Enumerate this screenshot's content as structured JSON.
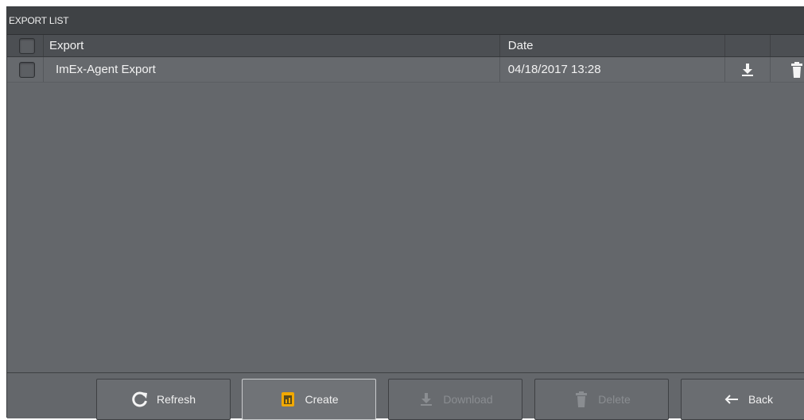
{
  "window": {
    "title": "EXPORT LIST"
  },
  "table": {
    "columns": {
      "export": "Export",
      "date": "Date"
    },
    "rows": [
      {
        "name": "ImEx-Agent Export",
        "date": "04/18/2017 13:28"
      }
    ]
  },
  "footer": {
    "refresh": "Refresh",
    "create": "Create",
    "download": "Download",
    "delete": "Delete",
    "back": "Back"
  },
  "colors": {
    "accent": "#f2a900",
    "panel": "#64676b",
    "header": "#3f4245"
  }
}
